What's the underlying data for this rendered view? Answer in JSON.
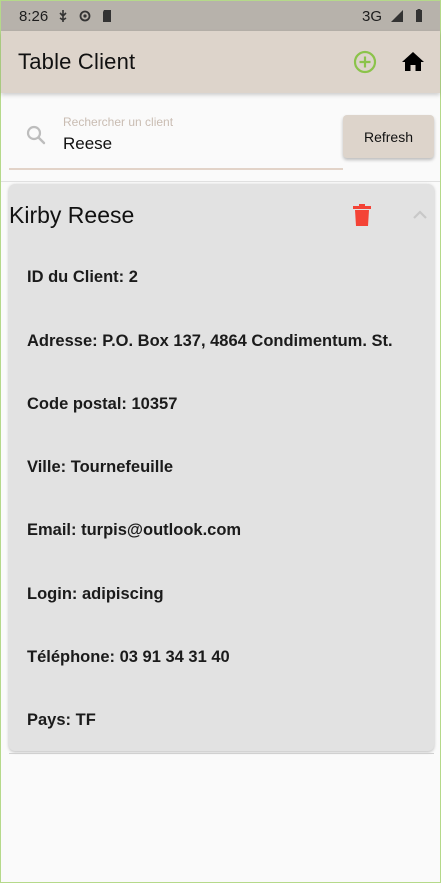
{
  "status_bar": {
    "time": "8:26",
    "network": "3G"
  },
  "app_bar": {
    "title": "Table Client",
    "add_icon": "add-circle-icon",
    "home_icon": "home-icon",
    "accent_color": "#8bc34a"
  },
  "search": {
    "label": "Rechercher un client",
    "value": "Reese",
    "refresh_label": "Refresh"
  },
  "client": {
    "name": "Kirby Reese",
    "fields": [
      "ID du Client: 2",
      "Adresse: P.O. Box 137, 4864 Condimentum. St.",
      "Code postal: 10357",
      "Ville: Tournefeuille",
      "Email: turpis@outlook.com",
      "Login: adipiscing",
      "Téléphone: 03 91 34 31 40",
      "Pays: TF"
    ],
    "delete_color": "#f44336"
  }
}
